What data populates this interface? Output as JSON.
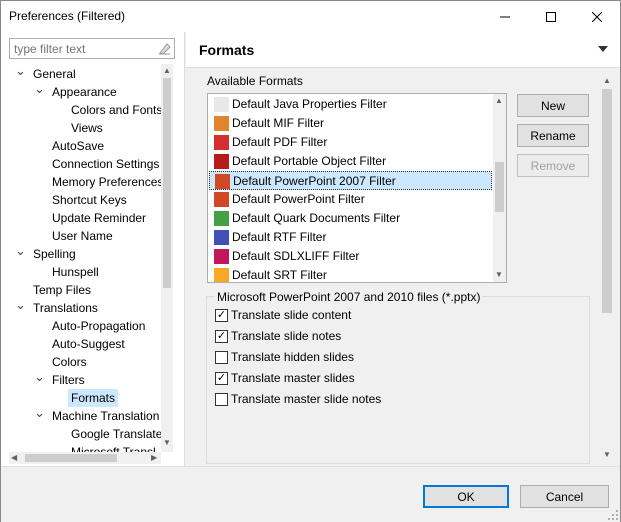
{
  "window": {
    "title": "Preferences (Filtered)"
  },
  "filter": {
    "placeholder": "type filter text"
  },
  "tree": [
    {
      "label": "General",
      "level": 0,
      "expanded": true
    },
    {
      "label": "Appearance",
      "level": 1,
      "expanded": true
    },
    {
      "label": "Colors and Fonts",
      "level": 2
    },
    {
      "label": "Views",
      "level": 2
    },
    {
      "label": "AutoSave",
      "level": 1
    },
    {
      "label": "Connection Settings",
      "level": 1
    },
    {
      "label": "Memory Preferences",
      "level": 1
    },
    {
      "label": "Shortcut Keys",
      "level": 1
    },
    {
      "label": "Update Reminder",
      "level": 1
    },
    {
      "label": "User Name",
      "level": 1
    },
    {
      "label": "Spelling",
      "level": 0,
      "expanded": true
    },
    {
      "label": "Hunspell",
      "level": 1
    },
    {
      "label": "Temp Files",
      "level": 0
    },
    {
      "label": "Translations",
      "level": 0,
      "expanded": true
    },
    {
      "label": "Auto-Propagation",
      "level": 1
    },
    {
      "label": "Auto-Suggest",
      "level": 1
    },
    {
      "label": "Colors",
      "level": 1
    },
    {
      "label": "Filters",
      "level": 1,
      "expanded": true
    },
    {
      "label": "Formats",
      "level": 2,
      "selected": true
    },
    {
      "label": "Machine Translation",
      "level": 1,
      "expanded": true
    },
    {
      "label": "Google Translate",
      "level": 2
    },
    {
      "label": "Microsoft Transl...",
      "level": 2
    }
  ],
  "page": {
    "title": "Formats"
  },
  "available_formats": {
    "label": "Available Formats",
    "items": [
      {
        "label": "Default Java Properties Filter",
        "icon": "java-file-icon",
        "color": "#e8e8e8"
      },
      {
        "label": "Default MIF Filter",
        "icon": "mif-file-icon",
        "color": "#e0852b"
      },
      {
        "label": "Default PDF Filter",
        "icon": "pdf-file-icon",
        "color": "#d32f2f"
      },
      {
        "label": "Default Portable Object Filter",
        "icon": "po-file-icon",
        "color": "#b71c1c"
      },
      {
        "label": "Default PowerPoint 2007 Filter",
        "icon": "pptx-file-icon",
        "color": "#d24726",
        "selected": true
      },
      {
        "label": "Default PowerPoint Filter",
        "icon": "ppt-file-icon",
        "color": "#d24726"
      },
      {
        "label": "Default Quark Documents Filter",
        "icon": "quark-file-icon",
        "color": "#43a047"
      },
      {
        "label": "Default RTF Filter",
        "icon": "rtf-file-icon",
        "color": "#3f51b5"
      },
      {
        "label": "Default SDLXLIFF Filter",
        "icon": "sdlxliff-file-icon",
        "color": "#c2185b"
      },
      {
        "label": "Default SRT Filter",
        "icon": "srt-file-icon",
        "color": "#f9a825"
      }
    ]
  },
  "buttons": {
    "new": "New",
    "rename": "Rename",
    "remove": "Remove",
    "ok": "OK",
    "cancel": "Cancel"
  },
  "options": {
    "label": "Microsoft PowerPoint 2007 and 2010 files (*.pptx)",
    "items": [
      {
        "label": "Translate slide content",
        "checked": true
      },
      {
        "label": "Translate slide notes",
        "checked": true
      },
      {
        "label": "Translate hidden slides",
        "checked": false
      },
      {
        "label": "Translate master slides",
        "checked": true
      },
      {
        "label": "Translate master slide notes",
        "checked": false
      }
    ]
  },
  "colors": {
    "selection": "#cce8ff",
    "accent": "#0078d7"
  }
}
